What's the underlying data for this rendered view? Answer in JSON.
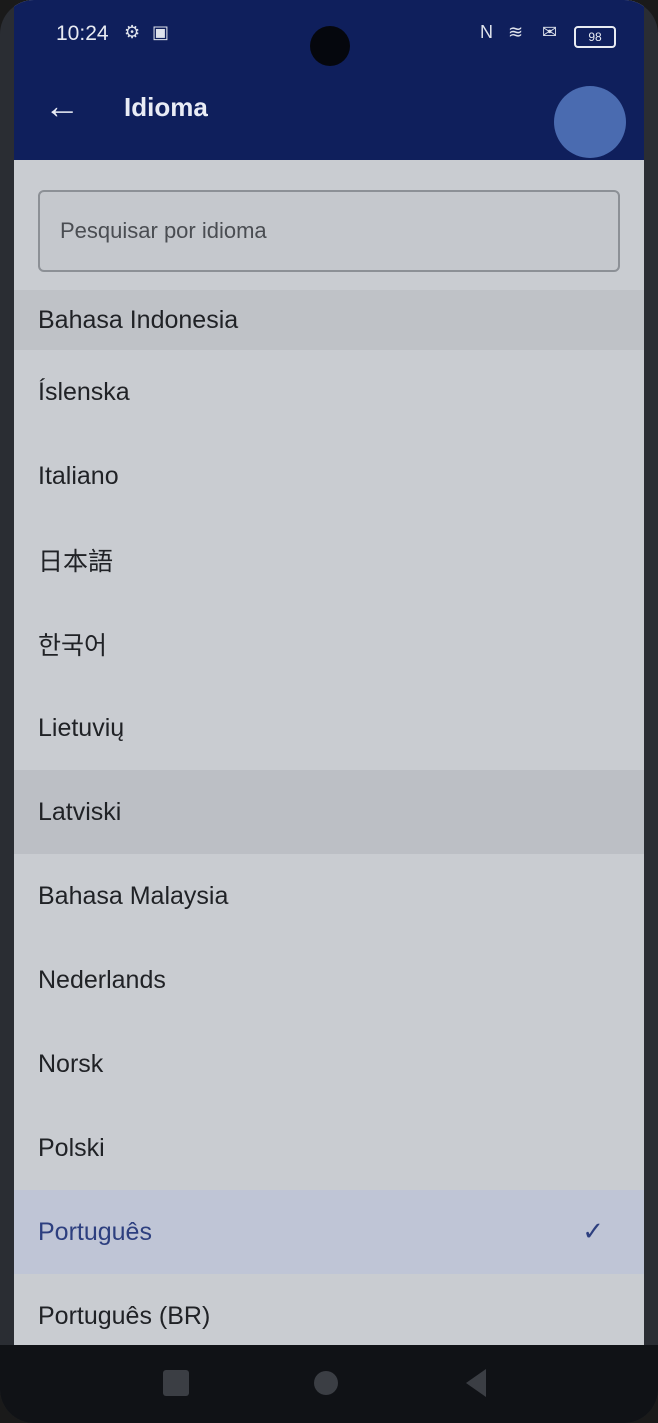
{
  "status": {
    "time": "10:24",
    "battery": "98"
  },
  "header": {
    "title": "Idioma"
  },
  "search": {
    "placeholder": "Pesquisar por idioma"
  },
  "languages": [
    "Bahasa Indonesia",
    "Íslenska",
    "Italiano",
    "日本語",
    "한국어",
    "Lietuvių",
    "Latviski",
    "Bahasa Malaysia",
    "Nederlands",
    "Norsk",
    "Polski",
    "Português",
    "Português (BR)"
  ],
  "selected_language": "Português",
  "check_symbol": "✓",
  "colors": {
    "appbar": "#0f1f5c",
    "selected_text": "#2d3f7f"
  }
}
